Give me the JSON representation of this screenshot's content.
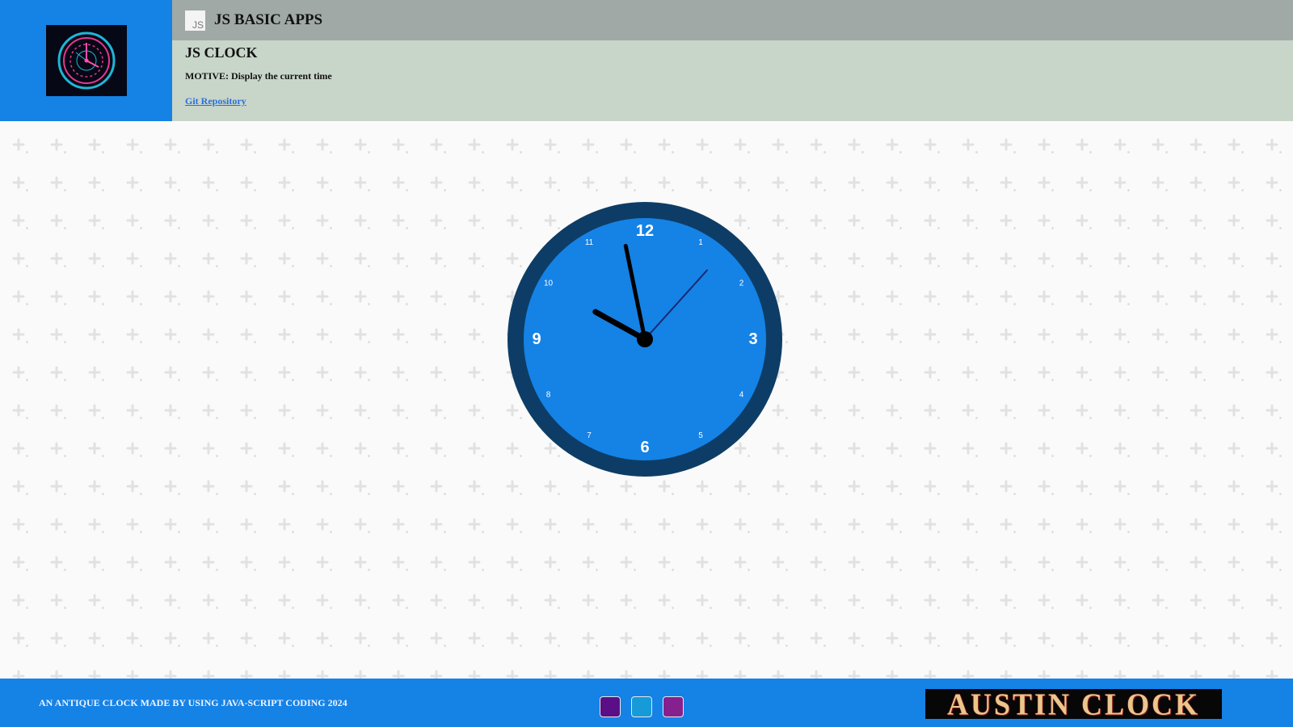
{
  "header": {
    "app_title": "JS BASIC APPS",
    "js_badge": "JS",
    "page_title": "JS CLOCK",
    "motive": "MOTIVE: Display the current time",
    "repo_link": "Git Repository"
  },
  "clock": {
    "numerals_major": [
      "12",
      "3",
      "6",
      "9"
    ],
    "numerals_minor": [
      "1",
      "2",
      "4",
      "5",
      "7",
      "8",
      "10",
      "11"
    ],
    "time": {
      "hour": 9,
      "minute": 58,
      "second": 4
    },
    "colors": {
      "rim": "#0d3d66",
      "face": "#1582e6",
      "numerals": "#ffffff",
      "hands": "#000000",
      "second_hand": "#172a6e"
    }
  },
  "footer": {
    "caption": "AN ANTIQUE CLOCK MADE BY USING JAVA-SCRIPT CODING 2024",
    "swatches": [
      "#5a0f86",
      "#169bd8",
      "#86208f"
    ],
    "banner_text": "AUSTIN CLOCK"
  },
  "colors": {
    "header_bar": "#a1a9a6",
    "info_panel": "#c8d6ca",
    "accent_blue": "#1582e6"
  }
}
